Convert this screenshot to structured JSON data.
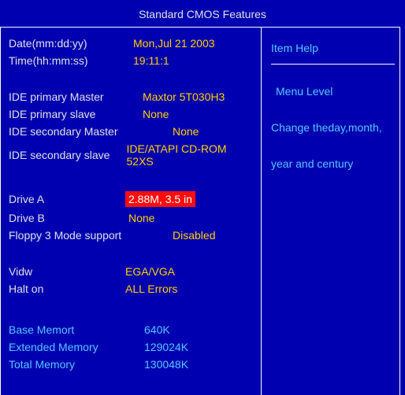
{
  "title": "Standard CMOS Features",
  "left": {
    "date_label": "Date(mm:dd:yy)",
    "date_value": "Mon,Jul 21 2003",
    "time_label": "Time(hh:mm:ss)",
    "time_value": "19:11:1",
    "ide_pm_label": "IDE primary Master",
    "ide_pm_value": "Maxtor 5T030H3",
    "ide_ps_label": "IDE primary slave",
    "ide_ps_value": "None",
    "ide_sm_label": "IDE secondary Master",
    "ide_sm_value": "None",
    "ide_ss_label": "IDE secondary slave",
    "ide_ss_value": "IDE/ATAPI CD-ROM 52XS",
    "drive_a_label": "Drive A",
    "drive_a_value": "2.88M, 3.5 in",
    "drive_b_label": "Drive B",
    "drive_b_value": "None",
    "floppy3_label": "Floppy 3 Mode support",
    "floppy3_value": "Disabled",
    "video_label": "Vidw",
    "video_value": "EGA/VGA",
    "halt_label": "Halt on",
    "halt_value": "ALL Errors",
    "basemem_label": "Base Memort",
    "basemem_value": "640K",
    "extmem_label": "Extended Memory",
    "extmem_value": "129024K",
    "totmem_label": "Total Memory",
    "totmem_value": "130048K"
  },
  "right": {
    "item_help": "Item Help",
    "menu_level": "Menu Level",
    "help_line1": "Change theday,month,",
    "help_line2": "year and century"
  }
}
